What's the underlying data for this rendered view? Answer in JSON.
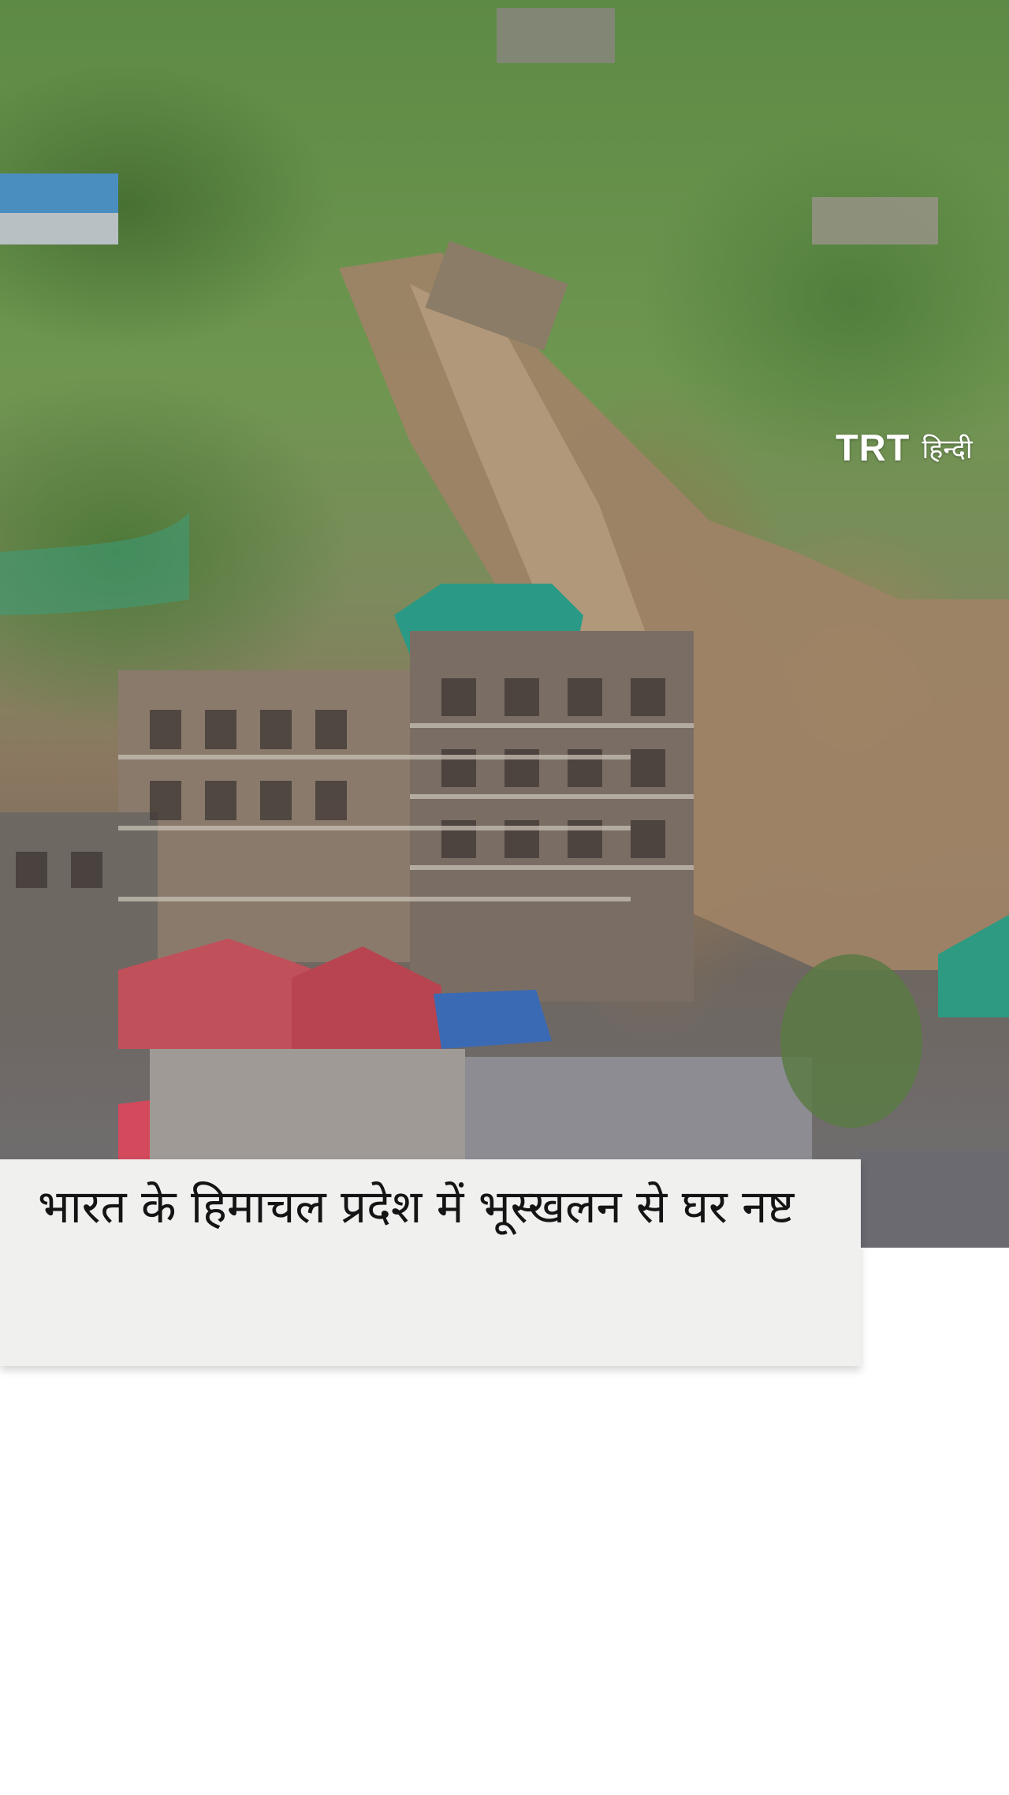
{
  "hero": {
    "image_semantic": "landslide-video-frame"
  },
  "channel": {
    "name": "TRT",
    "language_label": "हिन्दी"
  },
  "caption": {
    "headline": "भारत के हिमाचल प्रदेश में भूस्खलन से घर नष्ट"
  },
  "colors": {
    "card_background": "#f0f0ef",
    "headline_text": "#141414",
    "label_text": "#ffffff",
    "page_background": "#ffffff"
  }
}
